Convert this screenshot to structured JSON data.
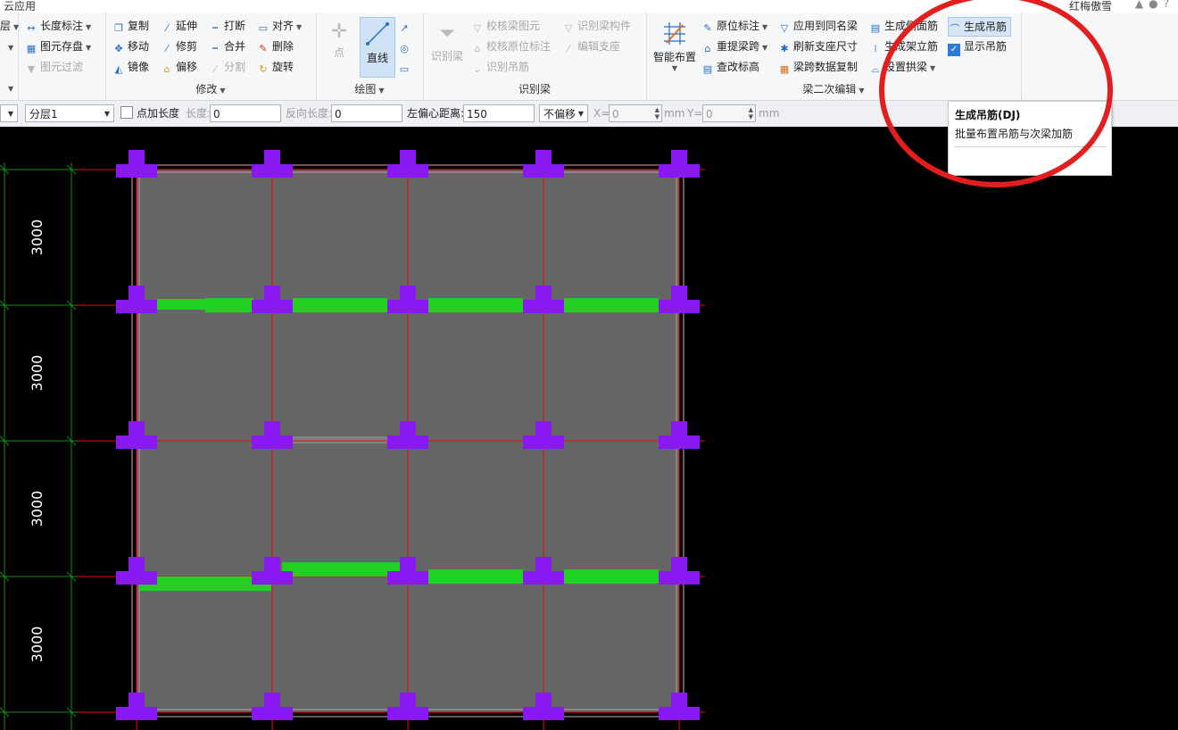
{
  "window": {
    "app_name": "云应用",
    "user_name": "红梅傲雪"
  },
  "ribbon": {
    "left_group": {
      "items": [
        "层",
        "",
        ""
      ]
    },
    "common": {
      "dim_label": "长度标注",
      "save_label": "图元存盘",
      "filter_label": "图元过滤"
    },
    "modify": {
      "title": "修改",
      "items": [
        "复制",
        "延伸",
        "打断",
        "对齐",
        "移动",
        "修剪",
        "合并",
        "删除",
        "镜像",
        "偏移",
        "分割",
        "旋转"
      ]
    },
    "draw": {
      "title": "绘图",
      "point_label": "点",
      "line_label": "直线"
    },
    "recognize": {
      "title": "识别梁",
      "big_label": "识别梁",
      "items": [
        "校核梁图元",
        "识别梁构件",
        "校核原位标注",
        "编辑支座",
        "识别吊筋"
      ]
    },
    "beam_edit": {
      "title": "梁二次编辑",
      "smart_label": "智能布置",
      "items": [
        "原位标注",
        "应用到同名梁",
        "生成侧面筋",
        "生成吊筋",
        "重提梁跨",
        "刷新支座尺寸",
        "生成架立筋",
        "显示吊筋",
        "查改标高",
        "梁跨数据复制",
        "设置拱梁"
      ]
    }
  },
  "options": {
    "layer_select": "分层1",
    "add_length_label": "点加长度",
    "length_label": "长度:",
    "length_value": "0",
    "reverse_length_label": "反向长度:",
    "reverse_length_value": "0",
    "left_offset_label": "左偏心距离:",
    "left_offset_value": "150",
    "offset_select": "不偏移",
    "x_label": "X=",
    "x_value": "0",
    "y_label": "Y=",
    "y_value": "0",
    "unit": "mm"
  },
  "tooltip": {
    "title": "生成吊筋(DJ)",
    "desc": "批量布置吊筋与次梁加筋"
  },
  "dimensions": [
    "3000",
    "3000",
    "3000",
    "3000"
  ],
  "colors": {
    "column": "#8a18f0",
    "beam_green": "#22d022",
    "axis_red": "#e01010",
    "slab_gray": "#666666",
    "dim_green": "#1a8a1a",
    "annotation_red": "#e21e1e"
  }
}
